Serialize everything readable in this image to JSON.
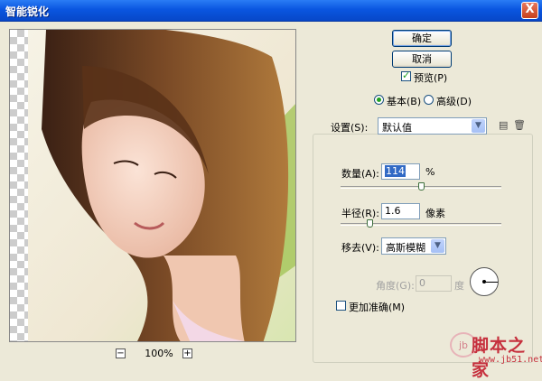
{
  "window": {
    "title": "智能锐化",
    "close_label": "X"
  },
  "buttons": {
    "ok": "确定",
    "cancel": "取消"
  },
  "preview_checkbox": {
    "label": "预览(P)",
    "checked": true
  },
  "mode": {
    "basic": "基本(B)",
    "advanced": "高级(D)",
    "selected": "basic"
  },
  "settings": {
    "label": "设置(S):",
    "value": "默认值"
  },
  "amount": {
    "label": "数量(A):",
    "value": "114",
    "unit": "%",
    "slider_fraction": 0.5
  },
  "radius": {
    "label": "半径(R):",
    "value": "1.6",
    "unit": "像素",
    "slider_fraction": 0.18
  },
  "remove": {
    "label": "移去(V):",
    "value": "高斯模糊"
  },
  "angle": {
    "label": "角度(G):",
    "value": "0",
    "unit": "度"
  },
  "more_accurate": {
    "label": "更加准确(M)",
    "checked": false
  },
  "zoom": {
    "minus": "−",
    "plus": "+",
    "value": "100%"
  },
  "watermark": {
    "text": "脚本之家",
    "url": "www.jb51.net",
    "logo_text": "jb"
  },
  "colors": {
    "title_bar": "#0a56e0",
    "dialog_bg": "#ece9d8",
    "check_green": "#21a121"
  }
}
